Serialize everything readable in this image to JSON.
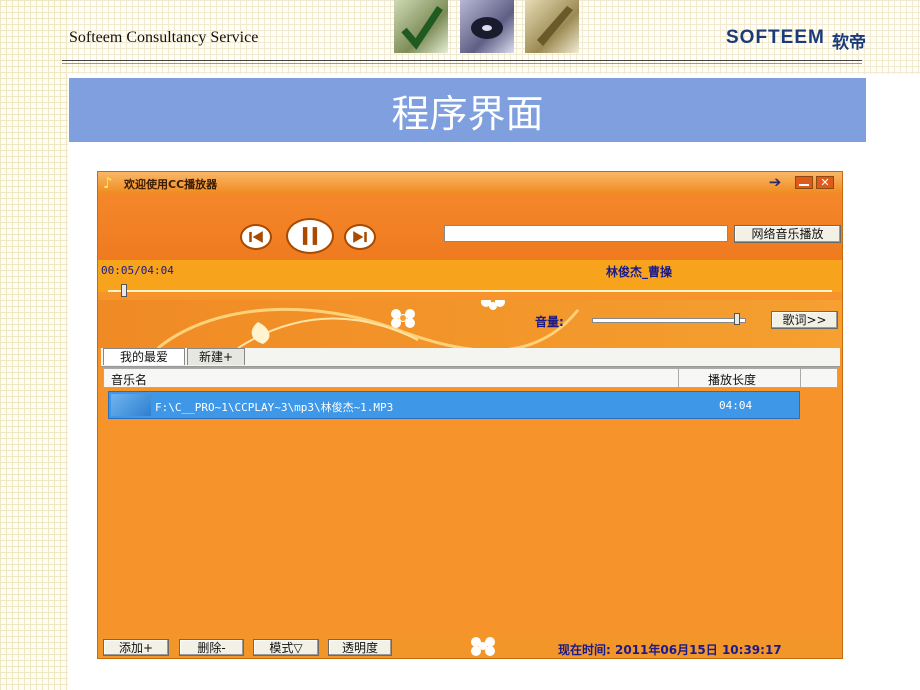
{
  "slide": {
    "company": "Softeem Consultancy Service",
    "brand": "SOFTEEM",
    "brand_cn": "软帝",
    "title": "程序界面"
  },
  "window": {
    "title": "欢迎使用CC播放器",
    "arrow_label": "➔",
    "min_label": "",
    "close_label": "✕"
  },
  "player": {
    "net_button": "网络音乐播放",
    "url_value": "",
    "time": "00:05/04:04",
    "artist": "林俊杰_曹操",
    "progress": 0.02,
    "volume_label": "音量:",
    "volume": 0.95,
    "lyrics_button": "歌词>>"
  },
  "tabs": [
    "我的最爱",
    "新建+"
  ],
  "list": {
    "col_name": "音乐名",
    "col_duration": "播放长度",
    "rows": [
      {
        "path": "F:\\C__PRO~1\\CCPLAY~3\\mp3\\林俊杰~1.MP3",
        "duration": "04:04"
      }
    ]
  },
  "bottom": {
    "add": "添加+",
    "delete": "删除-",
    "mode": "模式▽",
    "transparency": "透明度",
    "clock": "现在时间: 2011年06月15日  10:39:17"
  },
  "colors": {
    "accent_orange": "#f6932a",
    "title_blue": "#7f9fdf",
    "row_blue": "#3f97e8"
  }
}
